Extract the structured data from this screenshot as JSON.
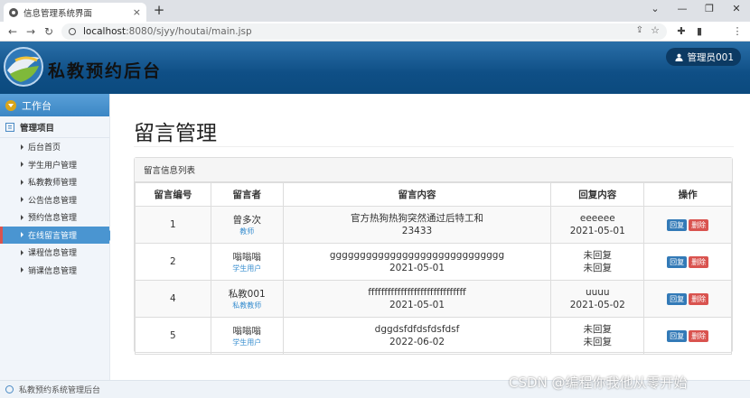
{
  "browser": {
    "tab_title": "信息管理系统界面",
    "tab_close": "×",
    "new_tab": "+",
    "url_host": "localhost",
    "url_path": ":8080/sjyy/houtai/main.jsp",
    "window_controls": [
      "⌄",
      "—",
      "❐",
      "✕"
    ]
  },
  "header": {
    "app_title": "私教预约后台",
    "user_label": "管理员001"
  },
  "sidebar": {
    "workbench": "工作台",
    "section": "管理项目",
    "items": [
      {
        "label": "后台首页"
      },
      {
        "label": "学生用户管理"
      },
      {
        "label": "私教教师管理"
      },
      {
        "label": "公告信息管理"
      },
      {
        "label": "预约信息管理"
      },
      {
        "label": "在线留言管理"
      },
      {
        "label": "课程信息管理"
      },
      {
        "label": "销课信息管理"
      }
    ],
    "active_index": 5
  },
  "main": {
    "page_title": "留言管理",
    "panel_title": "留言信息列表",
    "columns": [
      "留言编号",
      "留言者",
      "留言内容",
      "回复内容",
      "操作"
    ],
    "reply_label": "回复",
    "delete_label": "删除",
    "rows": [
      {
        "id": "1",
        "author": "曾多次",
        "role": "教师",
        "content": "官方热狗热狗突然通过后特工和",
        "content_date": "23433",
        "reply": "eeeeee",
        "reply_date": "2021-05-01"
      },
      {
        "id": "2",
        "author": "嗡嗡嗡",
        "role": "学生用户",
        "content": "ggggggggggggggggggggggggggggg",
        "content_date": "2021-05-01",
        "reply": "未回复",
        "reply_date": "未回复"
      },
      {
        "id": "4",
        "author": "私教001",
        "role": "私教教师",
        "content": "ffffffffffffffffffffffffffffff",
        "content_date": "2021-05-01",
        "reply": "uuuu",
        "reply_date": "2021-05-02"
      },
      {
        "id": "5",
        "author": "嗡嗡嗡",
        "role": "学生用户",
        "content": "dggdsfdfdsfdsfdsf",
        "content_date": "2022-06-02",
        "reply": "未回复",
        "reply_date": "未回复"
      }
    ]
  },
  "statusbar": {
    "text": "私教预约系统管理后台"
  },
  "watermark": "CSDN @编程你我他从零开始",
  "colors": {
    "header_bg": "#0f4f86",
    "sidebar_active": "#4a95d1",
    "reply_btn": "#337ab7",
    "delete_btn": "#d9534f",
    "role_text": "#3a8fd0"
  }
}
